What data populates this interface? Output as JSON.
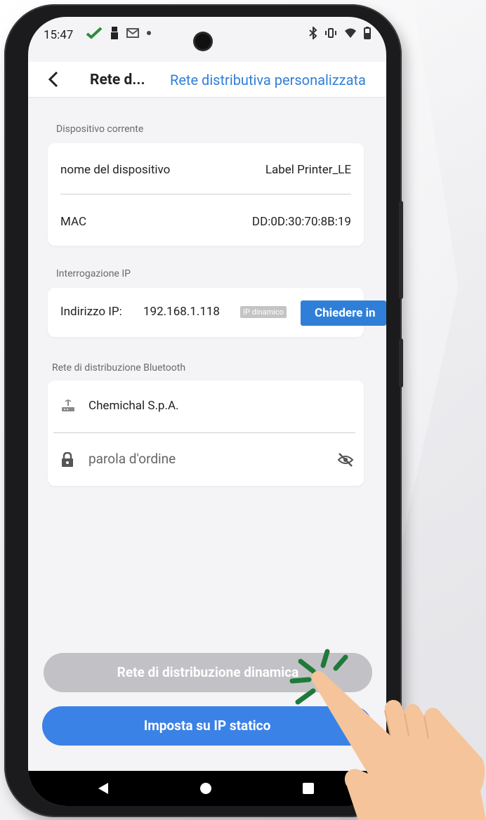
{
  "status_bar": {
    "time": "15:47"
  },
  "app_bar": {
    "title": "Rete d...",
    "link": "Rete distributiva personalizzata"
  },
  "device_section": {
    "label": "Dispositivo corrente",
    "rows": [
      {
        "label": "nome del dispositivo",
        "value": "Label Printer_LE"
      },
      {
        "label": "MAC",
        "value": "DD:0D:30:70:8B:19"
      }
    ]
  },
  "ip_section": {
    "label": "Interrogazione IP",
    "ip_label": "Indirizzo IP:",
    "ip_value": "192.168.1.118",
    "badge": "IP dinamico",
    "query_button": "Chiedere in"
  },
  "bluetooth_section": {
    "label": "Rete di distribuzione Bluetooth",
    "network_name": "Chemichal S.p.A.",
    "password_placeholder": "parola d'ordine"
  },
  "buttons": {
    "dynamic": "Rete di distribuzione dinamica",
    "static": "Imposta su IP statico"
  },
  "colors": {
    "accent": "#2f7fd8",
    "button_blue": "#3b82e6",
    "button_gray": "#c2c2c6",
    "tap_marks": "#1f7a3a",
    "hand": "#f5c49a"
  },
  "icons": [
    "back-arrow-icon",
    "router-icon",
    "lock-icon",
    "eye-off-icon",
    "nav-back-icon",
    "nav-home-icon",
    "nav-recents-icon"
  ]
}
